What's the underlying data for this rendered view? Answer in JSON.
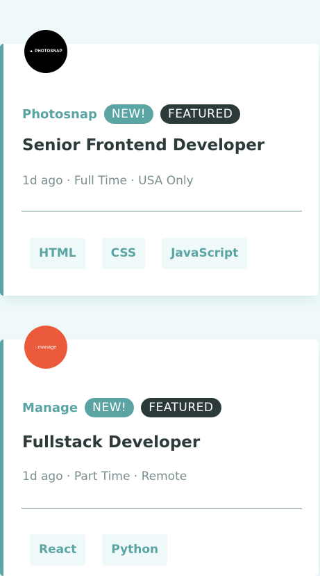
{
  "colors": {
    "page_background": "#eff9fa",
    "accent": "#5ba4a4",
    "dark": "#2c3a3a",
    "muted": "#7b8e8e",
    "photosnap_logo_bg": "#000000",
    "manage_logo_bg": "#eb5a3b"
  },
  "jobs": [
    {
      "logo_text": "▲ PHOTOSNAP",
      "company": "Photosnap",
      "new_label": "NEW!",
      "featured_label": "FEATURED",
      "position": "Senior Frontend Developer",
      "meta": "1d ago · Full Time · USA Only",
      "tags": [
        "HTML",
        "CSS",
        "JavaScript"
      ]
    },
    {
      "logo_text": "::manage",
      "company": "Manage",
      "new_label": "NEW!",
      "featured_label": "FEATURED",
      "position": "Fullstack Developer",
      "meta": "1d ago · Part Time · Remote",
      "tags": [
        "React",
        "Python"
      ]
    }
  ]
}
